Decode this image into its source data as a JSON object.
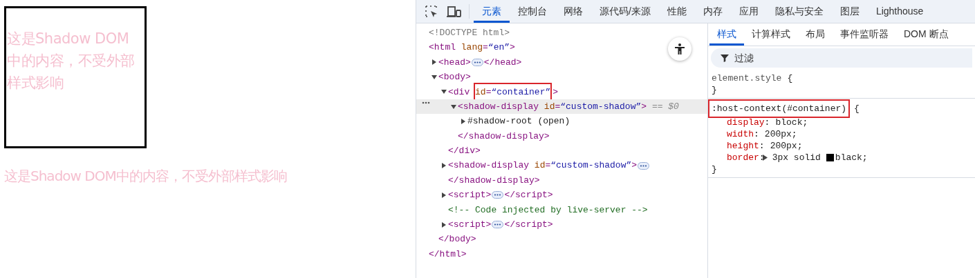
{
  "page": {
    "box_text": "这是Shadow DOM中的内容，不受外部样式影响",
    "plain_text": "这是Shadow DOM中的内容，不受外部样式影响"
  },
  "devtools": {
    "tabs": [
      {
        "label": "元素",
        "selected": true
      },
      {
        "label": "控制台",
        "selected": false
      },
      {
        "label": "网络",
        "selected": false
      },
      {
        "label": "源代码/来源",
        "selected": false
      },
      {
        "label": "性能",
        "selected": false
      },
      {
        "label": "内存",
        "selected": false
      },
      {
        "label": "应用",
        "selected": false
      },
      {
        "label": "隐私与安全",
        "selected": false
      },
      {
        "label": "图层",
        "selected": false
      },
      {
        "label": "Lighthouse",
        "selected": false
      }
    ],
    "dom_tree": [
      {
        "open": [
          {
            "kind": "doctype",
            "text": "<!DOCTYPE html>"
          }
        ]
      },
      {
        "open": [
          {
            "kind": "tag",
            "text": "<html "
          },
          {
            "kind": "attr",
            "text": "lang"
          },
          {
            "kind": "tag",
            "text": "="
          },
          {
            "kind": "value",
            "text": "“en”"
          },
          {
            "kind": "tag",
            "text": ">"
          }
        ],
        "close": [
          {
            "kind": "tag",
            "text": "</html>"
          }
        ],
        "children": [
          {
            "expanded": false,
            "open": [
              {
                "kind": "tag",
                "text": "<head>"
              }
            ],
            "close": [
              {
                "kind": "tag",
                "text": "</head>"
              }
            ]
          },
          {
            "expanded": true,
            "open": [
              {
                "kind": "tag",
                "text": "<body>"
              }
            ],
            "close": [
              {
                "kind": "tag",
                "text": "</body>"
              }
            ],
            "children": [
              {
                "expanded": true,
                "open": [
                  {
                    "kind": "tag",
                    "text": "<div "
                  },
                  {
                    "kind": "attr",
                    "text": "id",
                    "boxed": true
                  },
                  {
                    "kind": "tag",
                    "text": "=",
                    "boxed": true
                  },
                  {
                    "kind": "value",
                    "text": "“container”",
                    "boxed": true
                  },
                  {
                    "kind": "tag",
                    "text": ">"
                  }
                ],
                "close": [
                  {
                    "kind": "tag",
                    "text": "</div>"
                  }
                ],
                "children": [
                  {
                    "expanded": true,
                    "selected": true,
                    "open": [
                      {
                        "kind": "tag",
                        "text": "<shadow-display "
                      },
                      {
                        "kind": "attr",
                        "text": "id"
                      },
                      {
                        "kind": "tag",
                        "text": "="
                      },
                      {
                        "kind": "value",
                        "text": "“custom-shadow”"
                      },
                      {
                        "kind": "tag",
                        "text": ">"
                      },
                      {
                        "kind": "hint",
                        "text": " == $0"
                      }
                    ],
                    "close": [
                      {
                        "kind": "tag",
                        "text": "</shadow-display>"
                      }
                    ],
                    "children": [
                      {
                        "expanded": false,
                        "open": [
                          {
                            "kind": "text",
                            "text": "#shadow-root (open)"
                          }
                        ]
                      }
                    ]
                  }
                ]
              },
              {
                "expanded": false,
                "selected": false,
                "wrap_close": true,
                "open": [
                  {
                    "kind": "tag",
                    "text": "<shadow-display "
                  },
                  {
                    "kind": "attr",
                    "text": "id"
                  },
                  {
                    "kind": "tag",
                    "text": "="
                  },
                  {
                    "kind": "value",
                    "text": "“custom-shadow”"
                  },
                  {
                    "kind": "tag",
                    "text": ">"
                  }
                ],
                "close": [
                  {
                    "kind": "tag",
                    "text": "</shadow-display>"
                  }
                ]
              },
              {
                "expanded": false,
                "open": [
                  {
                    "kind": "tag",
                    "text": "<script>"
                  }
                ],
                "close": [
                  {
                    "kind": "tag",
                    "text": "</script>"
                  }
                ]
              },
              {
                "open": [
                  {
                    "kind": "comment",
                    "text": "<!-- Code injected by live-server -->"
                  }
                ]
              },
              {
                "expanded": false,
                "open": [
                  {
                    "kind": "tag",
                    "text": "<script>"
                  }
                ],
                "close": [
                  {
                    "kind": "tag",
                    "text": "</script>"
                  }
                ]
              }
            ]
          }
        ]
      }
    ],
    "styles_tabs": [
      {
        "label": "样式",
        "selected": true
      },
      {
        "label": "计算样式",
        "selected": false
      },
      {
        "label": "布局",
        "selected": false
      },
      {
        "label": "事件监听器",
        "selected": false
      },
      {
        "label": "DOM 断点",
        "selected": false
      }
    ],
    "filter": {
      "placeholder": "过滤"
    },
    "rules": [
      {
        "selector": "element.style",
        "boxed": false,
        "open_brace": "{",
        "close_brace": "}"
      },
      {
        "selector": ":host-context(#container)",
        "boxed": true,
        "open_brace": "{",
        "close_brace": "}",
        "properties": [
          {
            "name": "display",
            "colon": ":",
            "value": "block;"
          },
          {
            "name": "width",
            "colon": ":",
            "value": "200px;"
          },
          {
            "name": "height",
            "colon": ":",
            "value": "200px;"
          },
          {
            "name": "border",
            "colon": ":",
            "value": "3px solid",
            "expandable": true,
            "color": "#000000",
            "after_swatch": "black;"
          }
        ]
      }
    ]
  }
}
